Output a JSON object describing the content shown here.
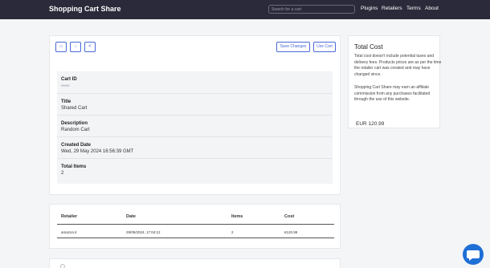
{
  "header": {
    "brand": "Shopping Cart Share",
    "search_placeholder": "Search for a cart",
    "nav": [
      "Plugins",
      "Retailers",
      "Terms",
      "About"
    ]
  },
  "toolbar": {
    "icons": [
      "home-icon",
      "download-icon",
      "share-icon"
    ],
    "save_label": "Save Changes",
    "use_label": "Use Cart"
  },
  "cart": {
    "id_label": "Cart ID",
    "id_value": "•••••",
    "title_label": "Title",
    "title_value": "Shared Cart",
    "description_label": "Description",
    "description_value": "Random Cart",
    "created_label": "Created Date",
    "created_value": "Wed, 29 May 2024 16:56:39 GMT",
    "items_label": "Total Items",
    "items_value": "2"
  },
  "retailers_table": {
    "headers": [
      "Retailer",
      "Date",
      "Items",
      "Cost"
    ],
    "rows": [
      [
        "amazon.it",
        "29/05/2024, 17:04:12",
        "2",
        "€120.99"
      ]
    ]
  },
  "sidebar": {
    "title": "Total Cost",
    "note1": "Total cost doesn't include potential taxes and delivery fees. Products prices are as per the time the retailer cart was created and may have changed since.",
    "note2": "Shopping Cart Share may earn an affiliate commission from any purchases facilitated through the use of this website.",
    "total": "EUR 120.99"
  },
  "colors": {
    "navbar": "#2a2a3a",
    "accent": "#4a68d8",
    "chat": "#1f6fd6"
  }
}
